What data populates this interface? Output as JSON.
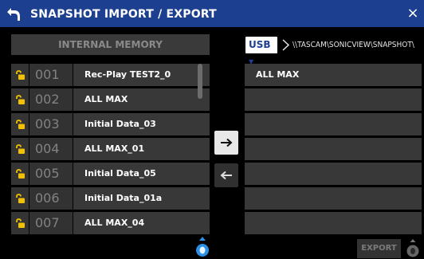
{
  "header": {
    "title": "SNAPSHOT IMPORT / EXPORT",
    "close_label": "×"
  },
  "internal": {
    "header_label": "INTERNAL MEMORY",
    "items": [
      {
        "number": "001",
        "name": "Rec-Play TEST2_0"
      },
      {
        "number": "002",
        "name": "ALL MAX"
      },
      {
        "number": "003",
        "name": "Initial Data_03"
      },
      {
        "number": "004",
        "name": "ALL MAX_01"
      },
      {
        "number": "005",
        "name": "Initial Data_05"
      },
      {
        "number": "006",
        "name": "Initial Data_01a"
      },
      {
        "number": "007",
        "name": "ALL MAX_04"
      }
    ]
  },
  "usb": {
    "source_label": "USB",
    "path": "\\\\TASCAM\\SONICVIEW\\SNAPSHOT\\",
    "items": [
      {
        "name": "ALL MAX"
      },
      {
        "name": ""
      },
      {
        "name": ""
      },
      {
        "name": ""
      },
      {
        "name": ""
      },
      {
        "name": ""
      },
      {
        "name": ""
      }
    ]
  },
  "footer": {
    "export_label": "EXPORT"
  },
  "colors": {
    "title_bar": "#1c3f8f",
    "lock_icon": "#f2c200",
    "knob_active": "#2b8fe6"
  },
  "icons": {
    "back": "back-arrow-icon",
    "close": "close-icon",
    "lock": "unlocked-padlock-icon",
    "copy_right": "arrow-right-icon",
    "copy_left": "arrow-left-icon",
    "encoder": "encoder-knob-icon"
  }
}
